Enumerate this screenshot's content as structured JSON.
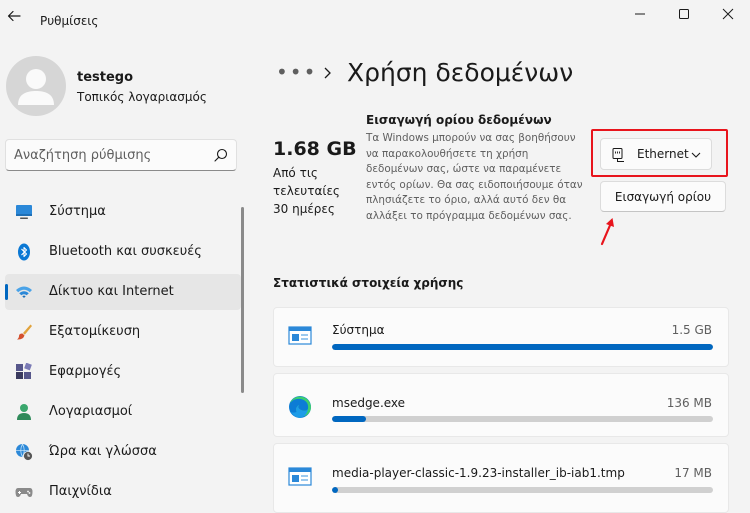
{
  "window": {
    "title": "Ρυθμίσεις"
  },
  "user": {
    "name": "testego",
    "account_type": "Τοπικός λογαριασμός"
  },
  "search": {
    "placeholder": "Αναζήτηση ρύθμισης"
  },
  "nav": {
    "items": [
      {
        "label": "Σύστημα",
        "icon": "monitor-icon"
      },
      {
        "label": "Bluetooth και συσκευές",
        "icon": "bluetooth-icon"
      },
      {
        "label": "Δίκτυο και Internet",
        "icon": "wifi-icon",
        "active": true
      },
      {
        "label": "Εξατομίκευση",
        "icon": "brush-icon"
      },
      {
        "label": "Εφαρμογές",
        "icon": "apps-icon"
      },
      {
        "label": "Λογαριασμοί",
        "icon": "person-icon"
      },
      {
        "label": "Ώρα και γλώσσα",
        "icon": "clock-globe-icon"
      },
      {
        "label": "Παιχνίδια",
        "icon": "gamepad-icon"
      }
    ]
  },
  "header": {
    "breadcrumb_more": "•••",
    "title": "Χρήση δεδομένων"
  },
  "summary": {
    "amount": "1.68 GB",
    "period_lines": [
      "Από τις",
      "τελευταίες",
      "30 ημέρες"
    ]
  },
  "data_limit": {
    "heading": "Εισαγωγή ορίου δεδομένων",
    "description": "Τα Windows μπορούν να σας βοηθήσουν να παρακολουθήσετε τη χρήση δεδομένων σας, ώστε να παραμένετε εντός ορίων. Θα σας ειδοποιήσουμε όταν πλησιάζετε το όριο, αλλά αυτό δεν θα αλλάξει το πρόγραμμα δεδομένων σας.",
    "network_selected": "Ethernet",
    "set_limit_label": "Εισαγωγή ορίου"
  },
  "stats": {
    "heading": "Στατιστικά στοιχεία χρήσης",
    "rows": [
      {
        "name": "Σύστημα",
        "size": "1.5 GB",
        "usage_fraction": 1.0,
        "icon": "system-app-icon"
      },
      {
        "name": "msedge.exe",
        "size": "136 MB",
        "usage_fraction": 0.09,
        "icon": "edge-icon"
      },
      {
        "name": "media-player-classic-1.9.23-installer_ib-iab1.tmp",
        "size": "17 MB",
        "usage_fraction": 0.015,
        "icon": "installer-icon"
      }
    ]
  },
  "colors": {
    "accent": "#0067c0",
    "annotation": "#e8141c",
    "background": "#f3f3f3"
  }
}
